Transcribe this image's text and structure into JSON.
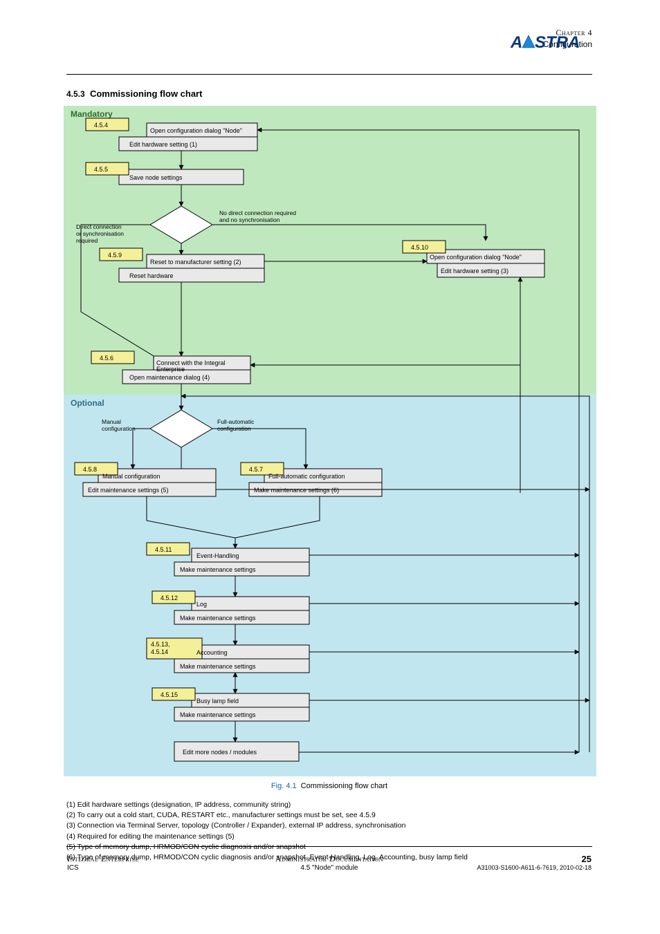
{
  "brand": {
    "wordmark_prefix": "A",
    "wordmark_suffix": "STRA"
  },
  "chapter": {
    "number": "Chapter 4",
    "title": "Configuration"
  },
  "section": {
    "number": "4.5.3",
    "title": "Commissioning flow chart"
  },
  "diagram": {
    "region_top_label": "Mandatory",
    "region_bottom_label": "Optional",
    "nodes": {
      "n1_tag": "4.5.4",
      "n1_top": "Open configuration dialog \"Node\"",
      "n1_bot": "Edit hardware setting (1)",
      "n2_tag": "4.5.5",
      "n2_text": "Save node settings",
      "d1": "",
      "dec1_left": "Direct connection or synchronisation required",
      "dec1_right": "No direct connection required and no synchronisation",
      "n3_tag": "4.5.9",
      "n3_top": "Reset to manufacturer setting (2)",
      "n3_bot": "Reset hardware",
      "n4_tag": "4.5.10",
      "n4_top": "Open configuration dialog \"Node\"",
      "n4_bot": "Edit hardware setting (3)",
      "n5_top": "Connect with the Integral Enterprise",
      "n5_bot": "Open maintenance dialog (4)",
      "n5_tag": "4.5.6",
      "dec2_left": "Manual\nconfiguration",
      "dec2_right": "Full-automatic\nconfiguration",
      "n6_tag": "4.5.8",
      "n6_top": "Manual configuration",
      "n6_bot": "Edit maintenance settings (5)",
      "n7_tag": "4.5.7",
      "n7_top": "Full-automatic configuration",
      "n7_bot": "Make maintenance settings (6)",
      "n8_tag": "4.5.11",
      "n8_top": "Event-Handling",
      "n8_bot": "Make maintenance settings",
      "n9_tag": "4.5.12",
      "n9_top": "Log",
      "n9_bot": "Make maintenance settings",
      "n10_tag": "4.5.13, 4.5.14",
      "n10_top": "Accounting",
      "n10_bot": "Make maintenance settings",
      "n11_tag": "4.5.15",
      "n11_top": "Busy lamp field",
      "n11_bot": "Make maintenance settings",
      "n12_text": "Edit more nodes / modules"
    },
    "annotations": [
      "(1) Edit hardware settings (designation, IP address, community string)",
      "(2) To carry out a cold start, CUDA, RESTART etc., manufacturer settings must be set, see 4.5.9",
      "(3) Connection via Terminal Server, topology (Controller / Expander), external IP address, synchronisation",
      "(4) Required for editing the maintenance settings (5)",
      "(5) Type of memory dump, HRMOD/CON cyclic diagnosis and/or snapshot",
      "(6) Type of memory dump, HRMOD/CON cyclic diagnosis and/or snapshot, Event-Handling, Log, Accounting, busy lamp field"
    ]
  },
  "figure": {
    "number": "Fig. 4.1",
    "caption": "Commissioning flow chart"
  },
  "footer": {
    "col1_l1": "Integral Enterprise",
    "col1_l2": "ICS",
    "col2_l1": "Administrator Documentation",
    "col2_l2": "4.5 \"Node\" module",
    "col3": "25",
    "col3_sub": "A31003-S1600-A611-6-7619, 2010-02-18"
  }
}
